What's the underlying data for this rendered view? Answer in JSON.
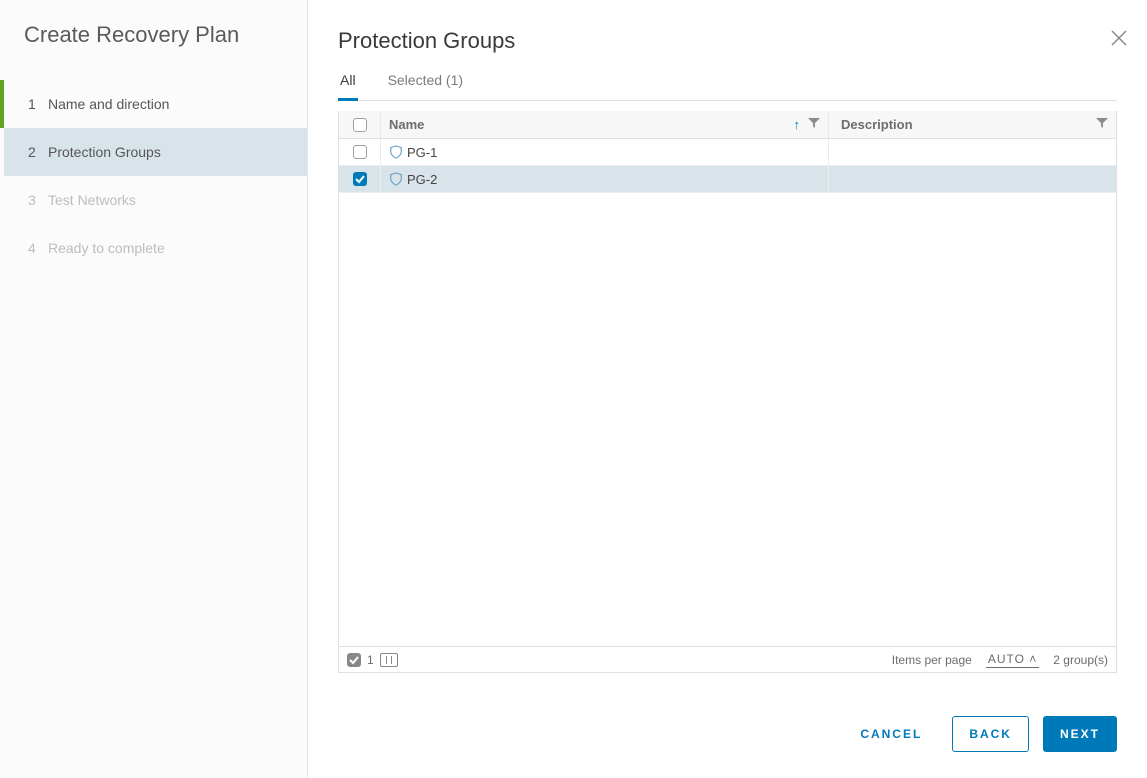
{
  "sidebar": {
    "title": "Create Recovery Plan",
    "steps": [
      {
        "num": "1",
        "label": "Name and direction",
        "state": "completed"
      },
      {
        "num": "2",
        "label": "Protection Groups",
        "state": "current"
      },
      {
        "num": "3",
        "label": "Test Networks",
        "state": "upcoming"
      },
      {
        "num": "4",
        "label": "Ready to complete",
        "state": "upcoming"
      }
    ]
  },
  "main": {
    "title": "Protection Groups",
    "tabs": {
      "all": "All",
      "selected": "Selected (1)"
    },
    "columns": {
      "name": "Name",
      "description": "Description"
    },
    "rows": [
      {
        "name": "PG-1",
        "description": "",
        "selected": false
      },
      {
        "name": "PG-2",
        "description": "",
        "selected": true
      }
    ],
    "footer": {
      "selected_count": "1",
      "items_per_page_label": "Items per page",
      "items_per_page_value": "AUTO",
      "total_label": "2 group(s)"
    }
  },
  "actions": {
    "cancel": "CANCEL",
    "back": "BACK",
    "next": "NEXT"
  }
}
